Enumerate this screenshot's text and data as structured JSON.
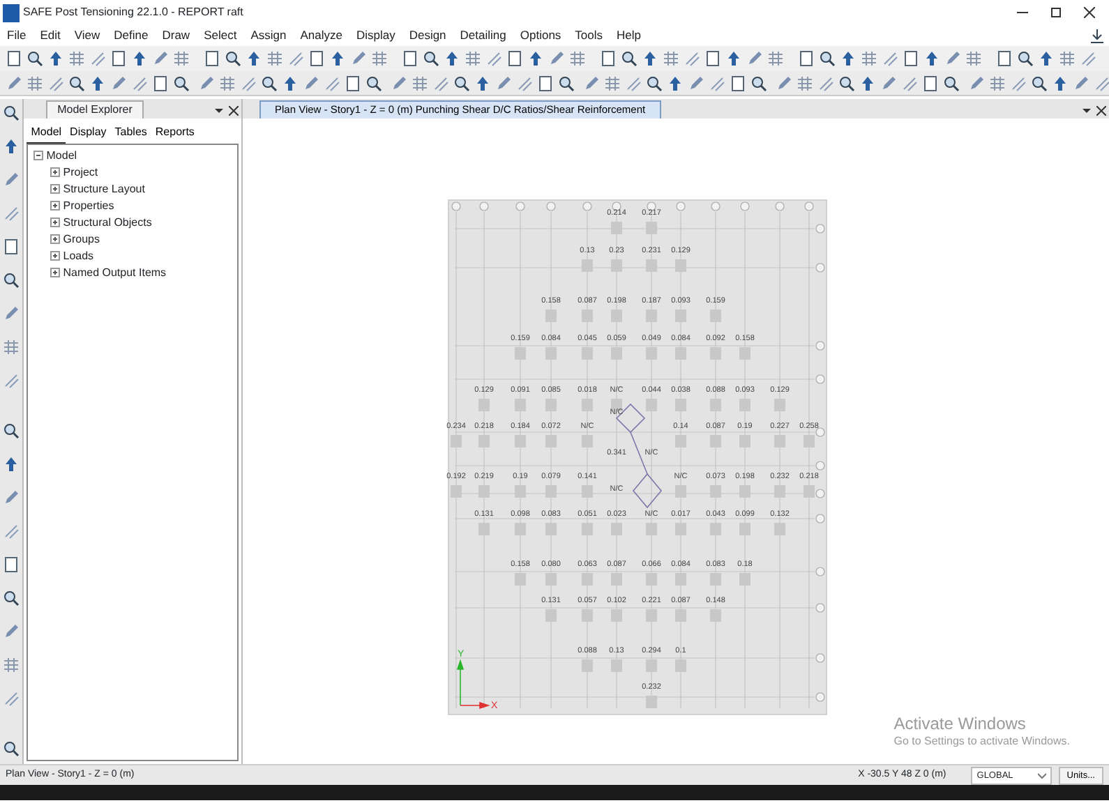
{
  "window": {
    "title": "SAFE Post Tensioning 22.1.0 - REPORT raft"
  },
  "menu": [
    "File",
    "Edit",
    "View",
    "Define",
    "Draw",
    "Select",
    "Assign",
    "Analyze",
    "Display",
    "Design",
    "Detailing",
    "Options",
    "Tools",
    "Help"
  ],
  "explorer": {
    "title": "Model Explorer",
    "tabs": [
      {
        "label": "Model",
        "selected": true
      },
      {
        "label": "Display",
        "selected": false
      },
      {
        "label": "Tables",
        "selected": false
      },
      {
        "label": "Reports",
        "selected": false
      }
    ],
    "tree": {
      "label": "Model",
      "expanded": true,
      "children": [
        {
          "label": "Project",
          "expanded": false
        },
        {
          "label": "Structure Layout",
          "expanded": false
        },
        {
          "label": "Properties",
          "expanded": false
        },
        {
          "label": "Structural Objects",
          "expanded": false
        },
        {
          "label": "Groups",
          "expanded": false
        },
        {
          "label": "Loads",
          "expanded": false
        },
        {
          "label": "Named Output Items",
          "expanded": false
        }
      ]
    }
  },
  "view": {
    "tab": {
      "label": "Plan View - Story1 - Z = 0 (m)  Punching Shear D/C Ratios/Shear Reinforcement",
      "selected": true
    },
    "plan": {
      "rows": [
        [
          null,
          null,
          null,
          null,
          null,
          "0.214",
          "0.217",
          null,
          null,
          null,
          null,
          null
        ],
        [
          null,
          null,
          null,
          null,
          "0.13",
          "0.23",
          "0.231",
          "0.129",
          null,
          null,
          null,
          null
        ],
        [
          null,
          null,
          null,
          "0.158",
          "0.087",
          "0.198",
          "0.187",
          "0.093",
          "0.159",
          null,
          null,
          null
        ],
        [
          null,
          null,
          "0.159",
          "0.084",
          "0.045",
          "0.059",
          "0.049",
          "0.084",
          "0.092",
          "0.158",
          null,
          null
        ],
        [
          null,
          "0.129",
          "0.091",
          "0.085",
          "0.018",
          "N/C",
          "0.044",
          "0.038",
          "0.088",
          "0.093",
          "0.129",
          null
        ],
        [
          null,
          null,
          null,
          null,
          null,
          "N/C",
          null,
          null,
          null,
          null,
          null,
          null
        ],
        [
          "0.234",
          "0.218",
          "0.184",
          "0.072",
          "N/C",
          null,
          null,
          "0.14",
          "0.087",
          "0.19",
          "0.227",
          "0.258"
        ],
        [
          null,
          null,
          null,
          null,
          null,
          "0.341",
          "N/C",
          null,
          null,
          null,
          null,
          null
        ],
        [
          "0.192",
          "0.219",
          "0.19",
          "0.079",
          "0.141",
          null,
          null,
          "N/C",
          "0.073",
          "0.198",
          "0.232",
          "0.218"
        ],
        [
          null,
          null,
          null,
          null,
          null,
          "N/C",
          null,
          null,
          null,
          null,
          null,
          null
        ],
        [
          null,
          "0.131",
          "0.098",
          "0.083",
          "0.051",
          "0.023",
          "N/C",
          "0.017",
          "0.043",
          "0.099",
          "0.132",
          null
        ],
        [
          null,
          null,
          "0.158",
          "0.080",
          "0.063",
          "0.087",
          "0.066",
          "0.084",
          "0.083",
          "0.18",
          null,
          null
        ],
        [
          null,
          null,
          null,
          "0.131",
          "0.057",
          "0.102",
          "0.221",
          "0.087",
          "0.148",
          null,
          null,
          null
        ],
        [
          null,
          null,
          null,
          null,
          "0.088",
          "0.13",
          "0.294",
          "0.1",
          null,
          null,
          null,
          null
        ],
        [
          null,
          null,
          null,
          null,
          null,
          null,
          "0.232",
          null,
          null,
          null,
          null,
          null
        ]
      ],
      "axis_labels": [
        "Y",
        "X"
      ]
    }
  },
  "notice": {
    "title": "Activate Windows",
    "text": "Go to Settings to activate Windows."
  },
  "status_bar": {
    "view": "Plan View - Story1 - Z = 0 (m)",
    "coordinates": "X -30.5  Y 48  Z 0 (m)",
    "system": "GLOBAL",
    "units_button": "Units..."
  }
}
